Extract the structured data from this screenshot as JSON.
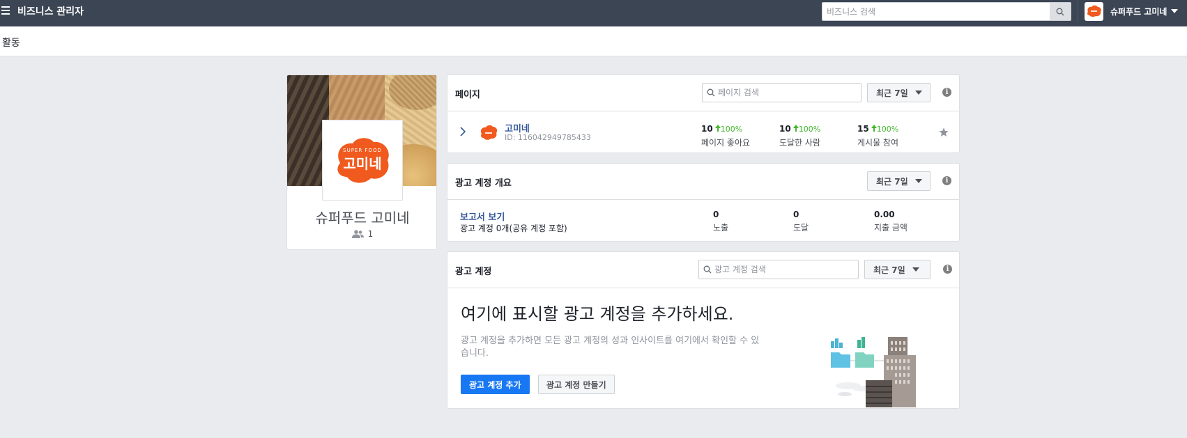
{
  "topbar": {
    "title": "비즈니스 관리자",
    "search_placeholder": "비즈니스 검색",
    "business_name": "슈퍼푸드 고미네"
  },
  "subbar": {
    "label": "활동"
  },
  "profile": {
    "business_name": "슈퍼푸드 고미네",
    "member_count": "1",
    "logo_text": "고미네",
    "logo_subtext": "SUPER FOOD"
  },
  "pages_card": {
    "title": "페이지",
    "search_placeholder": "페이지 검색",
    "period": "최근 7일",
    "info": "i",
    "page": {
      "name": "고미네",
      "id": "ID: 116042949785433",
      "metrics": [
        {
          "value": "10",
          "delta": "100%",
          "label": "페이지 좋아요"
        },
        {
          "value": "10",
          "delta": "100%",
          "label": "도달한 사람"
        },
        {
          "value": "15",
          "delta": "100%",
          "label": "게시물 참여"
        }
      ]
    }
  },
  "overview_card": {
    "title": "광고 계정 개요",
    "period": "최근 7일",
    "info": "i",
    "report_link": "보고서 보기",
    "account_count": "광고 계정 0개(공유 계정 포함)",
    "metrics": [
      {
        "value": "0",
        "label": "노출"
      },
      {
        "value": "0",
        "label": "도달"
      },
      {
        "value": "0.00",
        "label": "지출 금액"
      }
    ]
  },
  "ad_accounts_card": {
    "title": "광고 계정",
    "search_placeholder": "광고 계정 검색",
    "period": "최근 7일",
    "info": "i",
    "headline": "여기에 표시할 광고 계정을 추가하세요.",
    "description": "광고 계정을 추가하면 모든 광고 계정의 성과 인사이트를 여기에서 확인할 수 있습니다.",
    "add_button": "광고 계정 추가",
    "create_button": "광고 계정 만들기"
  },
  "colors": {
    "topbar": "#3b4554",
    "accent_blue": "#1877f2",
    "link": "#365899",
    "positive": "#42b72a",
    "brand_orange": "#f05a1e"
  },
  "icons": [
    "menu-icon",
    "search-icon",
    "chevron-down-icon",
    "people-icon",
    "chevron-right-icon",
    "arrow-up-icon",
    "star-icon",
    "info-icon"
  ]
}
